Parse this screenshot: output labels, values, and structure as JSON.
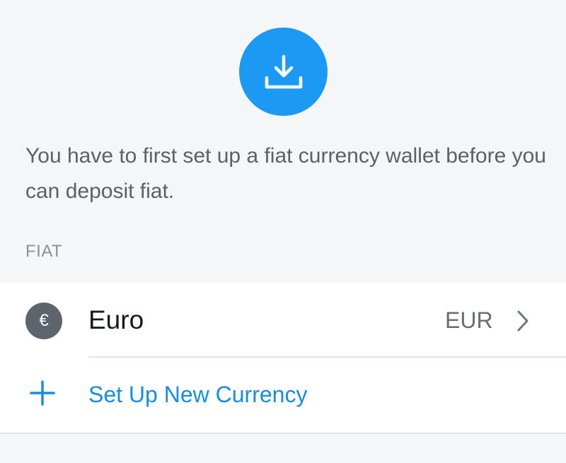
{
  "hero": {
    "icon": "download-icon",
    "color": "#1c9af3"
  },
  "message": "You have to first set up a fiat currency wallet before you can deposit fiat.",
  "section": {
    "label": "FIAT"
  },
  "currencies": [
    {
      "symbol": "€",
      "name": "Euro",
      "code": "EUR",
      "icon": "chevron-right-icon"
    }
  ],
  "add_currency": {
    "icon": "plus-icon",
    "label": "Set Up New Currency",
    "color": "#1a8ce0"
  }
}
